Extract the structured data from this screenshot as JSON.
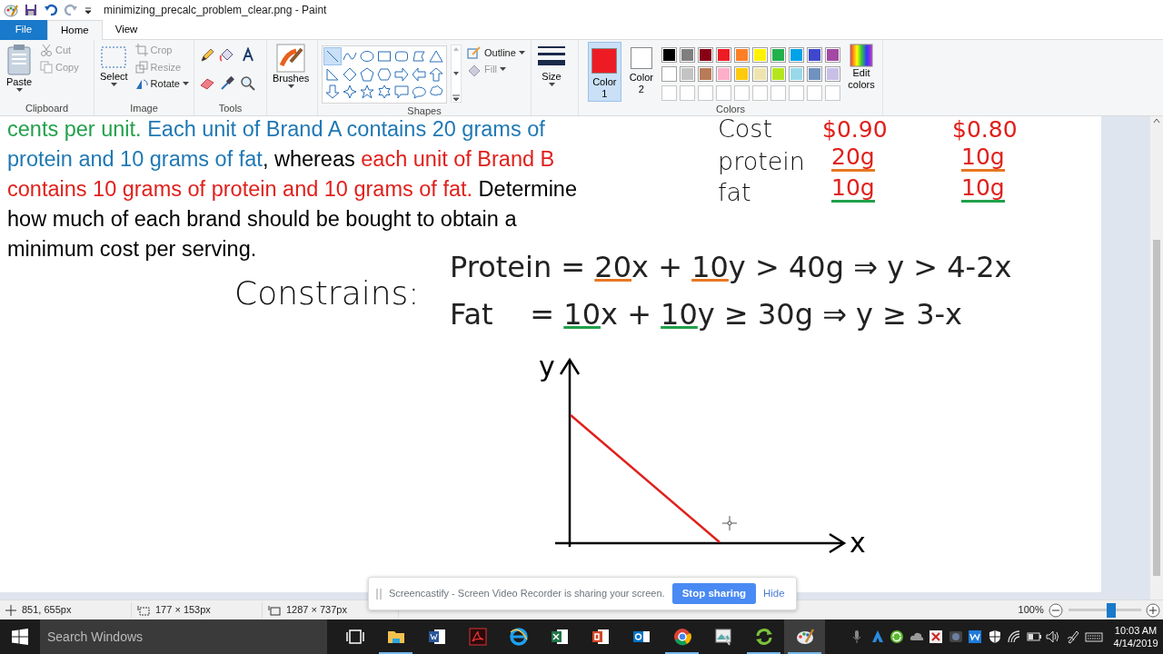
{
  "window": {
    "title": "minimizing_precalc_problem_clear.png - Paint"
  },
  "ribbon_tabs": [
    {
      "label": "File",
      "kind": "file",
      "selected": false
    },
    {
      "label": "Home",
      "kind": "tab",
      "selected": true
    },
    {
      "label": "View",
      "kind": "tab",
      "selected": false
    }
  ],
  "clipboard": {
    "paste": "Paste",
    "cut": "Cut",
    "copy": "Copy",
    "label": "Clipboard"
  },
  "image": {
    "select": "Select",
    "crop": "Crop",
    "resize": "Resize",
    "rotate": "Rotate",
    "label": "Image"
  },
  "tools": {
    "label": "Tools"
  },
  "brushes": {
    "button": "Brushes"
  },
  "shapes": {
    "label": "Shapes",
    "outline": "Outline",
    "fill": "Fill"
  },
  "size": {
    "button": "Size"
  },
  "colors": {
    "label": "Colors",
    "color1": {
      "label": "Color 1",
      "color": "#ed1c24",
      "selected": true
    },
    "color2": {
      "label": "Color 2",
      "color": "#ffffff",
      "selected": false
    },
    "edit": "Edit colors",
    "palette": [
      {
        "color": "#000000"
      },
      {
        "color": "#7f7f7f"
      },
      {
        "color": "#880015"
      },
      {
        "color": "#ed1c24"
      },
      {
        "color": "#ff7f27"
      },
      {
        "color": "#fff200"
      },
      {
        "color": "#22b14c"
      },
      {
        "color": "#00a2e8"
      },
      {
        "color": "#3f48cc"
      },
      {
        "color": "#a349a4"
      },
      {
        "color": "#ffffff"
      },
      {
        "color": "#c3c3c3"
      },
      {
        "color": "#b97a57"
      },
      {
        "color": "#ffaec9"
      },
      {
        "color": "#ffc90e"
      },
      {
        "color": "#efe4b0"
      },
      {
        "color": "#b5e61d"
      },
      {
        "color": "#99d9ea"
      },
      {
        "color": "#7092be"
      },
      {
        "color": "#c8bfe7"
      }
    ]
  },
  "canvas": {
    "paragraph": [
      [
        {
          "text": "cents per unit.",
          "color": "#22a04b"
        },
        {
          "text": " Each unit of Brand A contains 20 grams of",
          "color": "#1f78b4"
        }
      ],
      [
        {
          "text": "protein and 10 grams of fat",
          "color": "#1f78b4"
        },
        {
          "text": ", whereas ",
          "color": "#000000"
        },
        {
          "text": "each unit of Brand B",
          "color": "#e0201b"
        }
      ],
      [
        {
          "text": "contains 10 grams of protein and 10 grams of fat.",
          "color": "#e0201b"
        },
        {
          "text": " Determine",
          "color": "#000000"
        }
      ],
      [
        {
          "text": "how much of each brand should be bought to obtain a",
          "color": "#000000"
        }
      ],
      [
        {
          "text": "minimum cost per serving.",
          "color": "#000000"
        }
      ]
    ],
    "table": [
      {
        "label": "Cost",
        "a": {
          "text": "$0.90"
        },
        "b": {
          "text": "$0.80"
        }
      },
      {
        "label": "protein",
        "a": {
          "text": "20g",
          "underline": {
            "color": "#e87722"
          }
        },
        "b": {
          "text": "10g",
          "underline": {
            "color": "#e87722"
          }
        }
      },
      {
        "label": "fat",
        "a": {
          "text": "10g",
          "underline": {
            "color": "#22a04b"
          }
        },
        "b": {
          "text": "10g",
          "underline": {
            "color": "#22a04b"
          }
        }
      }
    ],
    "constraints_label": "Constrains:",
    "constraints": [
      [
        {
          "text": "Protein = "
        },
        {
          "text": "20",
          "underline": {
            "color": "#e87722"
          }
        },
        {
          "text": "x + "
        },
        {
          "text": "10",
          "underline": {
            "color": "#e87722"
          }
        },
        {
          "text": "y > 40g ⇒ y > 4-2x"
        }
      ],
      [
        {
          "text": "Fat    = "
        },
        {
          "text": "10",
          "underline": {
            "color": "#22a04b"
          }
        },
        {
          "text": "x + "
        },
        {
          "text": "10",
          "underline": {
            "color": "#22a04b"
          }
        },
        {
          "text": "y ≥ 30g ⇒ y ≥ 3-x"
        }
      ]
    ],
    "graph": {
      "y_label": "y",
      "x_label": "x"
    }
  },
  "status_bar": {
    "cursor": "851, 655px",
    "selection": "177 × 153px",
    "image_size": "1287 × 737px",
    "zoom": "100%",
    "zoom_level": {
      "level": 0.6
    }
  },
  "popup": {
    "message": "Screencastify - Screen Video Recorder is sharing your screen.",
    "stop": "Stop sharing",
    "hide": "Hide"
  },
  "taskbar": {
    "search_placeholder": "Search Windows",
    "apps": [
      {
        "kind": "taskview",
        "running": false,
        "active": false
      },
      {
        "kind": "explorer",
        "running": true,
        "active": false
      },
      {
        "kind": "word",
        "running": false,
        "active": false
      },
      {
        "kind": "acrobat",
        "running": false,
        "active": false
      },
      {
        "kind": "ie",
        "running": false,
        "active": false
      },
      {
        "kind": "excel",
        "running": false,
        "active": false
      },
      {
        "kind": "powerpoint",
        "running": false,
        "active": false
      },
      {
        "kind": "outlook",
        "running": false,
        "active": false
      },
      {
        "kind": "chrome",
        "running": true,
        "active": false
      },
      {
        "kind": "viewer",
        "running": false,
        "active": false
      },
      {
        "kind": "sync",
        "running": true,
        "active": false
      },
      {
        "kind": "paint",
        "running": true,
        "active": true
      }
    ],
    "time": "10:03 AM",
    "date": "4/14/2019"
  }
}
